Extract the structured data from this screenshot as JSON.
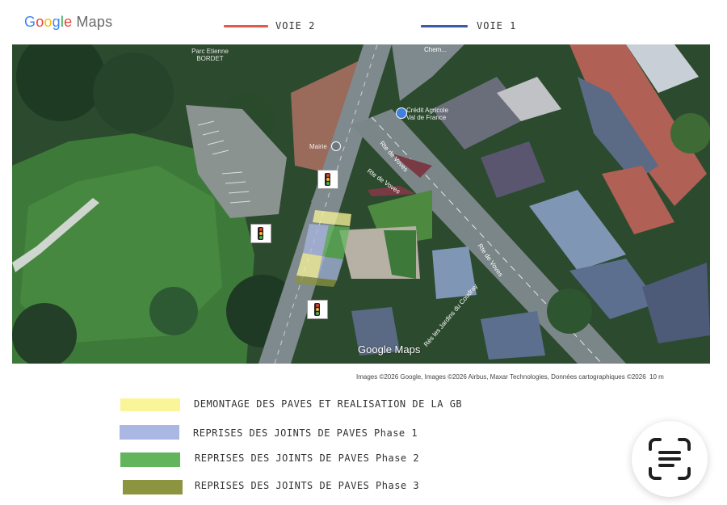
{
  "header": {
    "brand_google": "Google",
    "brand_maps": "Maps"
  },
  "top_legend": [
    {
      "label": "VOIE 2",
      "color": "#e05a4e"
    },
    {
      "label": "VOIE 1",
      "color": "#3c5aa6"
    }
  ],
  "map": {
    "labels": {
      "park": "Parc Etienne\nBORDET",
      "bank": "Crédit Agricole\nVal de France",
      "mairie": "Mairie",
      "road1": "Rte de Voves",
      "road2": "Rte de Voves",
      "road3": "Rte de Voves",
      "road4": "Rés les Jardins du Coudray",
      "chem": "Chem..."
    },
    "watermark": "Google Maps",
    "attribution": "Images ©2026 Google, Images ©2026 Airbus, Maxar Technologies, Données cartographiques ©2026",
    "scale": "10 m"
  },
  "work_legend": [
    {
      "label": "DEMONTAGE DES PAVES ET REALISATION DE LA GB",
      "color": "#fbf59a"
    },
    {
      "label": "REPRISES DES JOINTS DE PAVES Phase 1",
      "color": "#a9b7e2"
    },
    {
      "label": "REPRISES DES JOINTS DE PAVES Phase 2",
      "color": "#62b55c"
    },
    {
      "label": "REPRISES DES JOINTS DE PAVES Phase 3",
      "color": "#8c9440"
    }
  ],
  "icons": {
    "traffic_light": "traffic-light-icon",
    "bank": "bank-pin-icon",
    "mairie": "town-hall-pin-icon",
    "lens": "google-lens-icon"
  }
}
